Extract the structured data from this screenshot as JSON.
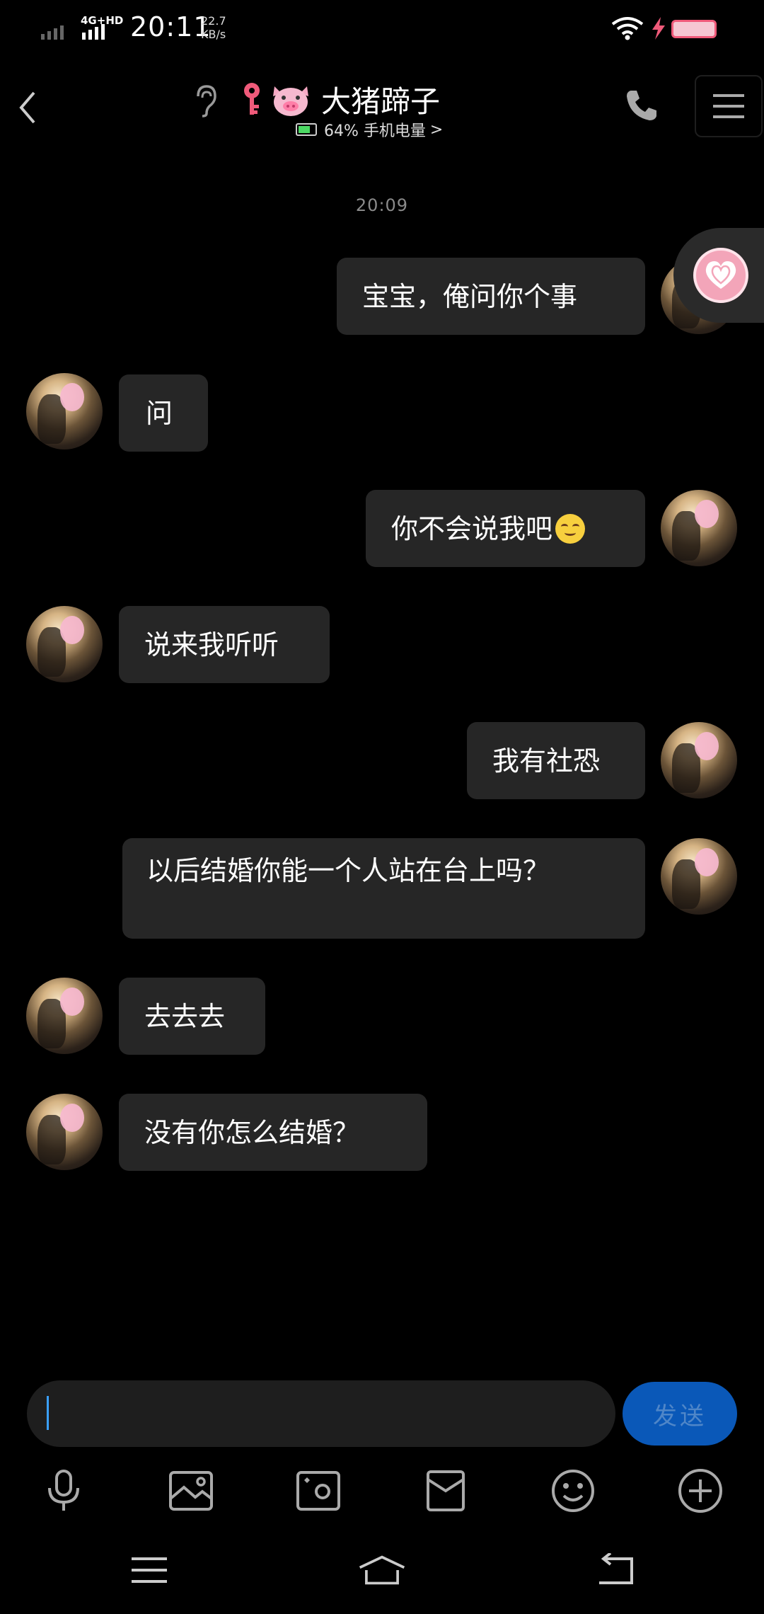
{
  "status_bar": {
    "network_type": "4G+HD",
    "time": "20:11",
    "speed_value": "22.7",
    "speed_unit": "KB/s",
    "icons": [
      "signal-icon",
      "wifi-icon",
      "charging-icon",
      "battery-icon"
    ]
  },
  "header": {
    "contact_name": "大猪蹄子",
    "phone_status": "64% 手机电量",
    "status_chevron": ">",
    "icons": [
      "back-icon",
      "ear-icon",
      "key-icon",
      "pig-icon",
      "phone-icon",
      "menu-icon"
    ]
  },
  "conversation": {
    "timestamp": "20:09",
    "messages": [
      {
        "side": "right",
        "text": "宝宝，俺问你个事"
      },
      {
        "side": "left",
        "text": "问"
      },
      {
        "side": "right",
        "text": "你不会说我吧",
        "emoji": "smile-emoji"
      },
      {
        "side": "left",
        "text": "说来我听听"
      },
      {
        "side": "right",
        "text": "我有社恐"
      },
      {
        "side": "right",
        "text": "以后结婚你能一个人站在台上吗？"
      },
      {
        "side": "left",
        "text": "去去去"
      },
      {
        "side": "left",
        "text": "没有你怎么结婚？"
      }
    ]
  },
  "input": {
    "value": "",
    "send_label": "发送"
  },
  "toolbar": {
    "items": [
      "mic-icon",
      "image-icon",
      "camera-icon",
      "red-packet-icon",
      "emoji-icon",
      "plus-icon"
    ]
  },
  "nav_bar": {
    "items": [
      "menu-icon",
      "home-icon",
      "back-icon"
    ]
  },
  "colors": {
    "background": "#000000",
    "bubble": "#262626",
    "send_button": "#0a58b8",
    "battery_accent": "#f05a7a"
  }
}
